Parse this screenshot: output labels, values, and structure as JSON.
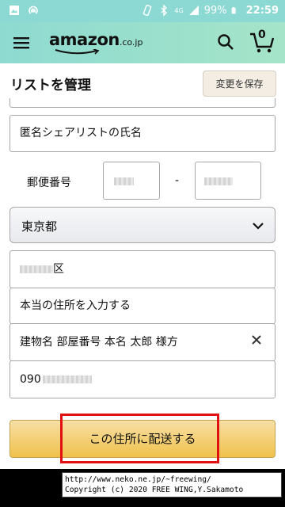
{
  "status_bar": {
    "battery": "99%",
    "network": "4G",
    "time": "22:59"
  },
  "header": {
    "logo_main": "amazon",
    "logo_suffix": ".co.jp",
    "cart_count": "0"
  },
  "subheader": {
    "title": "リストを管理",
    "save_label": "変更を保存"
  },
  "form": {
    "anon_name": "匿名シェアリストの氏名",
    "postal_label": "郵便番号",
    "postal_separator": "-",
    "prefecture": "東京都",
    "city_suffix": "区",
    "address_placeholder": "本当の住所を入力する",
    "building": "建物名 部屋番号 本名 太郎 様方",
    "phone_prefix": "090"
  },
  "deliver_button": {
    "label": "この住所に配送する"
  },
  "copyright": {
    "line1": "http://www.neko.ne.jp/~freewing/",
    "line2": "Copyright (c) 2020 FREE WING,Y.Sakamoto"
  },
  "colors": {
    "header_teal": "#8edad1",
    "button_gold": "#f0c14b",
    "highlight_red": "#e01010"
  }
}
